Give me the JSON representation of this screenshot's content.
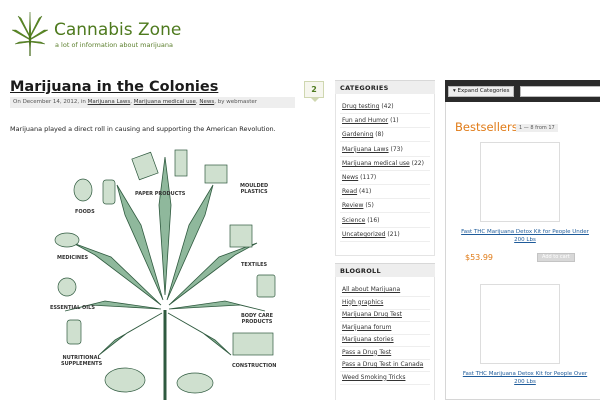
{
  "site": {
    "title": "Cannabis Zone",
    "tagline": "a lot of information about marijuana"
  },
  "post": {
    "title": "Marijuana in the Colonies",
    "meta_prefix": "On December 14, 2012, in",
    "categories": [
      "Marijuana Laws",
      "Marijuana medical use",
      "News"
    ],
    "meta_by": ", by webmaster",
    "comment_count": "2",
    "excerpt": "Marijuana played a direct roll in causing and supporting the American Revolution.",
    "illustration_labels": {
      "paper": "PAPER PRODUCTS",
      "moulded": "MOULDED\nPLASTICS",
      "foods": "FOODS",
      "textiles": "TEXTILES",
      "medicines": "MEDICINES",
      "essential_oils": "ESSENTIAL OILS",
      "body_care": "BODY CARE\nPRODUCTS",
      "nutritional": "NUTRITIONAL\nSUPPLEMENTS",
      "construction": "CONSTRUCTION"
    }
  },
  "sidebar": {
    "categories_title": "CATEGORIES",
    "categories": [
      {
        "name": "Drug testing",
        "count": "(42)"
      },
      {
        "name": "Fun and Humor",
        "count": "(1)"
      },
      {
        "name": "Gardening",
        "count": "(8)"
      },
      {
        "name": "Marijuana Laws",
        "count": "(73)"
      },
      {
        "name": "Marijuana medical use",
        "count": "(22)"
      },
      {
        "name": "News",
        "count": "(117)"
      },
      {
        "name": "Read",
        "count": "(41)"
      },
      {
        "name": "Review",
        "count": "(5)"
      },
      {
        "name": "Science",
        "count": "(16)"
      },
      {
        "name": "Uncategorized",
        "count": "(21)"
      }
    ],
    "blogroll_title": "BLOGROLL",
    "blogroll": [
      "All about Marijuana",
      "High graphics",
      "Marijuana Drug Test",
      "Marijuana forum",
      "Marijuana stories",
      "Pass a Drug Test",
      "Pass a Drug Test in Canada",
      "Weed Smoking Tricks"
    ]
  },
  "shop": {
    "expand_label": "▾ Expand Categories",
    "bestsellers_title": "Bestsellers",
    "range_label": "1 — 8 from 17",
    "products": [
      {
        "name": "Fast THC Marijuana Detox Kit for People Under 200 Lbs",
        "price": "$53.99",
        "cart_label": "Add to cart"
      },
      {
        "name": "Fast THC Marijuana Detox Kit for People Over 200 Lbs",
        "price": "",
        "cart_label": ""
      }
    ]
  },
  "colors": {
    "brand_green": "#4e7a1e",
    "leaf_green": "#8fb89c",
    "price_orange": "#e07b17",
    "link_blue": "#1e5b9a"
  }
}
